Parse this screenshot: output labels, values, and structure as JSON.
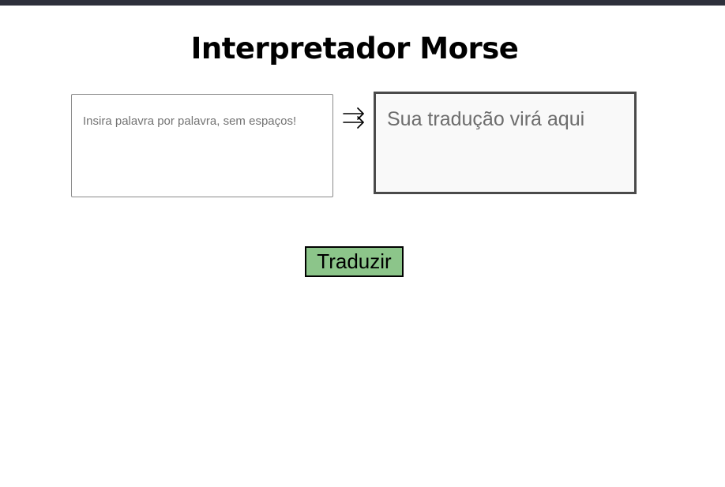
{
  "header": {
    "title": "Interpretador Morse"
  },
  "input": {
    "value": "",
    "placeholder": "Insira palavra por palavra, sem espaços!"
  },
  "arrow": {
    "icon": "right-double-arrow-icon"
  },
  "output": {
    "text": "Sua tradução virá aqui"
  },
  "actions": {
    "translate_label": "Traduzir"
  },
  "colors": {
    "top_bar": "#2e303b",
    "button_bg": "#8cc58a",
    "output_bg": "#f9f9f9",
    "output_border": "#4a4a4a"
  }
}
